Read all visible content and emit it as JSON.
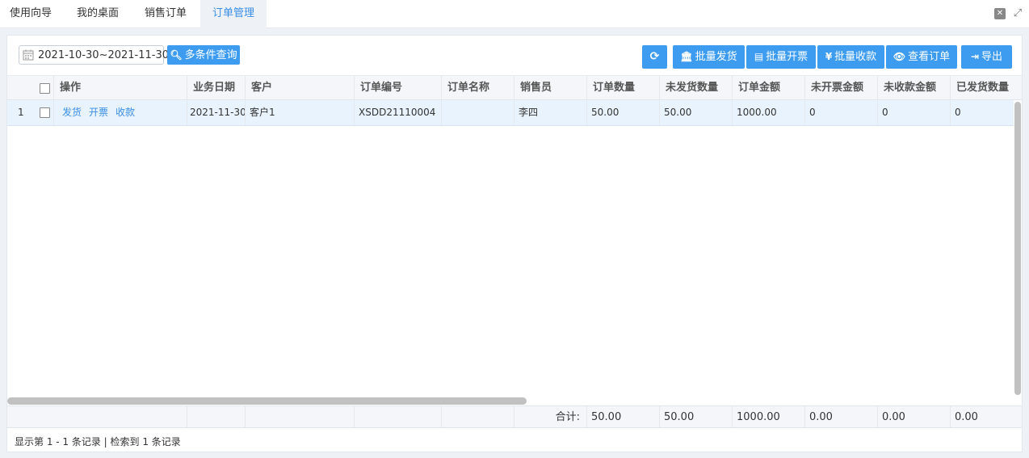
{
  "tabs": [
    {
      "label": "使用向导",
      "active": false
    },
    {
      "label": "我的桌面",
      "active": false
    },
    {
      "label": "销售订单",
      "active": false
    },
    {
      "label": "订单管理",
      "active": true
    }
  ],
  "window_controls": {
    "restore_icon": "close-square-icon",
    "fullscreen_icon": "expand-icon"
  },
  "toolbar": {
    "date_range": "2021-10-30~2021-11-30",
    "search_label": "多条件查询",
    "batch_ship_label": "批量发货",
    "batch_invoice_label": "批量开票",
    "batch_collect_label": "批量收款",
    "view_order_label": "查看订单",
    "export_label": "导出"
  },
  "table": {
    "headers": [
      "操作",
      "业务日期",
      "客户",
      "订单编号",
      "订单名称",
      "销售员",
      "订单数量",
      "未发货数量",
      "订单金额",
      "未开票金额",
      "未收款金额",
      "已发货数量"
    ],
    "rows": [
      {
        "index": "1",
        "actions": [
          "发货",
          "开票",
          "收款"
        ],
        "date": "2021-11-30",
        "customer": "客户1",
        "order_no": "XSDD21110004",
        "order_name": "",
        "salesperson": "李四",
        "qty": "50.00",
        "unshipped_qty": "50.00",
        "amount": "1000.00",
        "uninvoiced": "0",
        "uncollected": "0",
        "shipped_qty": "0"
      }
    ],
    "totals": {
      "label": "合计:",
      "qty": "50.00",
      "unshipped_qty": "50.00",
      "amount": "1000.00",
      "uninvoiced": "0.00",
      "uncollected": "0.00",
      "shipped_qty": "0.00"
    }
  },
  "status_text": "显示第 1 - 1 条记录 | 检索到 1 条记录",
  "colors": {
    "accent": "#3d9cf0",
    "link": "#3a8ee6",
    "selected_row": "#e9f3fd"
  }
}
